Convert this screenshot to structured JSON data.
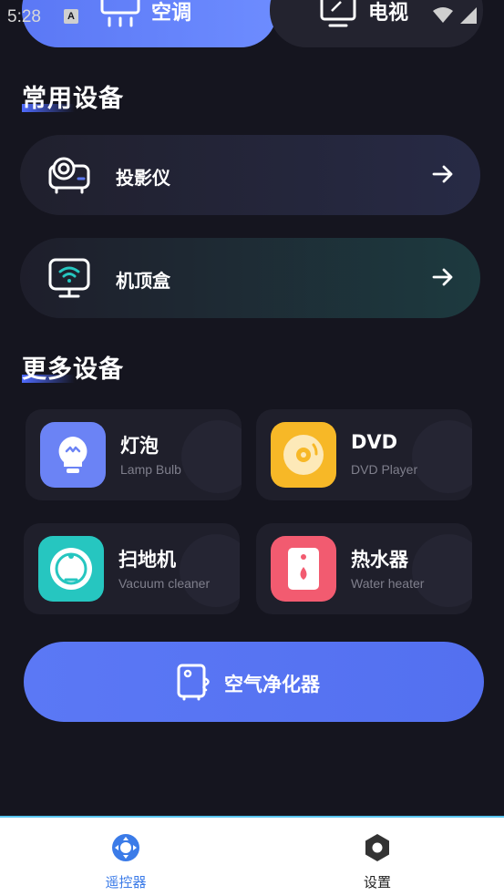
{
  "status_bar": {
    "time": "5:28",
    "notification_icon": "A"
  },
  "top_cards": {
    "air_conditioner_label": "空调",
    "tv_label": "电视"
  },
  "common_section": {
    "title": "常用设备",
    "items": [
      {
        "label": "投影仪",
        "icon": "projector-icon"
      },
      {
        "label": "机顶盒",
        "icon": "set-top-box-icon"
      }
    ]
  },
  "more_section": {
    "title": "更多设备",
    "tiles": [
      {
        "title": "灯泡",
        "subtitle": "Lamp Bulb",
        "icon": "bulb-icon",
        "color": "#6b83f5"
      },
      {
        "title": "DVD",
        "subtitle": "DVD Player",
        "icon": "disc-icon",
        "color": "#f7b827"
      },
      {
        "title": "扫地机",
        "subtitle": "Vacuum cleaner",
        "icon": "robot-vacuum-icon",
        "color": "#26c6c0"
      },
      {
        "title": "热水器",
        "subtitle": "Water heater",
        "icon": "water-heater-icon",
        "color": "#f25b70"
      }
    ]
  },
  "purifier_button": {
    "label": "空气净化器",
    "icon": "air-purifier-icon"
  },
  "bottom_nav": {
    "items": [
      {
        "label": "遥控器",
        "icon": "remote-icon",
        "active": true
      },
      {
        "label": "设置",
        "icon": "hexagon-settings-icon",
        "active": false
      }
    ]
  },
  "colors": {
    "background": "#15151f",
    "accent": "#5b78f5",
    "nav_active": "#3b7be8"
  }
}
